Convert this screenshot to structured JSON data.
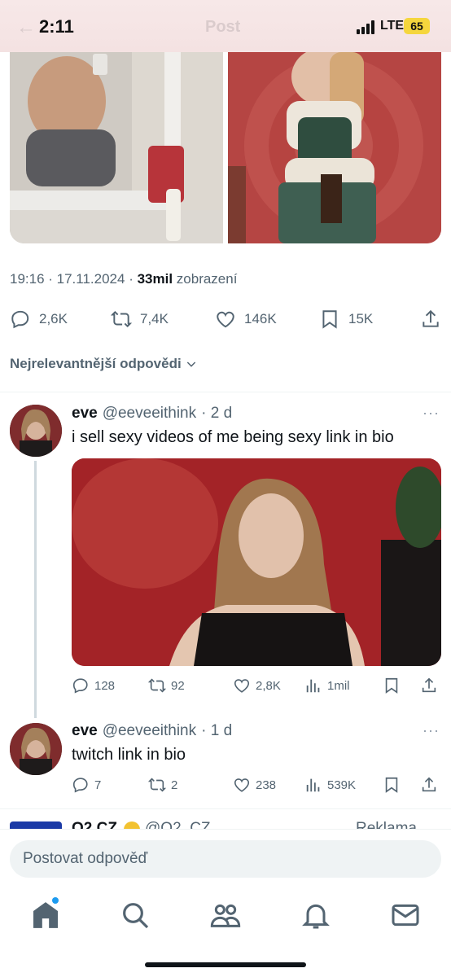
{
  "status_bar": {
    "time": "2:11",
    "network": "LTE",
    "battery": "65",
    "page_title": "Post"
  },
  "post": {
    "timestamp": "19:16 · 17.11.2024 · ",
    "views_count": "33mil",
    "views_label": " zobrazení",
    "stats": {
      "replies": "2,6K",
      "reposts": "7,4K",
      "likes": "146K",
      "bookmarks": "15K"
    }
  },
  "sort_label": "Nejrelevantnější odpovědi",
  "replies": [
    {
      "name": "eve",
      "handle": "@eeveeithink",
      "time": "· 2 d",
      "text": "i sell sexy videos of me being sexy link in bio",
      "stats": {
        "replies": "128",
        "reposts": "92",
        "likes": "2,8K",
        "views": "1mil"
      }
    },
    {
      "name": "eve",
      "handle": "@eeveeithink",
      "time": "· 1 d",
      "text": "twitch link in bio",
      "stats": {
        "replies": "7",
        "reposts": "2",
        "likes": "238",
        "views": "539K"
      }
    }
  ],
  "ad": {
    "name": "O2 CZ",
    "handle": "@O2_CZ",
    "label": "Reklama"
  },
  "compose": {
    "placeholder": "Postovat odpověď"
  },
  "more_glyph": "···",
  "icons": {
    "reply": "reply-icon",
    "repost": "repost-icon",
    "like": "heart-icon",
    "bookmark": "bookmark-icon",
    "share": "share-icon",
    "views": "views-icon"
  },
  "colors": {
    "accent": "#1d9bf0",
    "secondary_text": "#536471",
    "primary_text": "#0f1419"
  }
}
